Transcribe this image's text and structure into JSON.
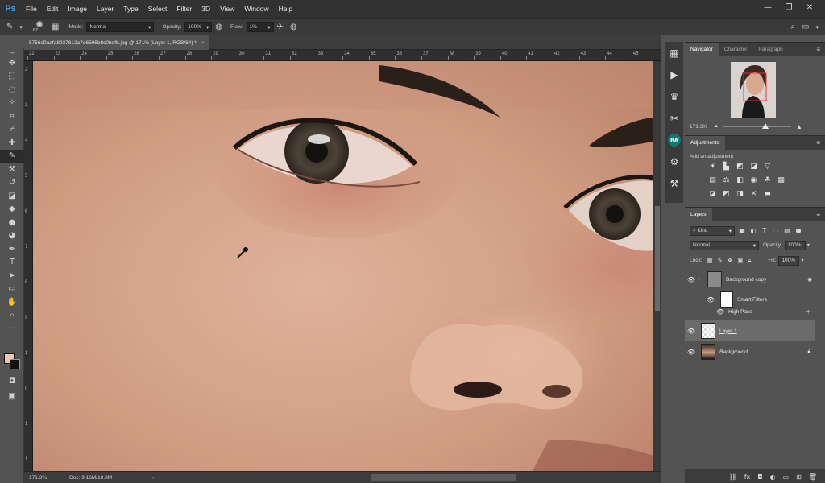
{
  "app": {
    "logo": "Ps"
  },
  "menu": [
    "File",
    "Edit",
    "Image",
    "Layer",
    "Type",
    "Select",
    "Filter",
    "3D",
    "View",
    "Window",
    "Help"
  ],
  "window_controls": [
    "—",
    "❐",
    "✕"
  ],
  "options_bar": {
    "brush_size": "67",
    "mode_label": "Mode:",
    "mode_value": "Normal",
    "opacity_label": "Opacity:",
    "opacity_value": "100%",
    "flow_label": "Flow:",
    "flow_value": "1%"
  },
  "document": {
    "tab_title": "5756d0aafa8937812a7d6595b8c0befb.jpg @ 171% (Layer 1, RGB/8#) *",
    "tab_close": "×"
  },
  "rulers": {
    "top": [
      "22",
      "23",
      "24",
      "25",
      "26",
      "27",
      "28",
      "29",
      "30",
      "31",
      "32",
      "33",
      "34",
      "35",
      "36",
      "37",
      "38",
      "39",
      "40",
      "41",
      "42",
      "43",
      "44",
      "45"
    ],
    "left": [
      "2",
      "3",
      "4",
      "5",
      "6",
      "7",
      "8",
      "9",
      "1",
      "0",
      "1",
      "1"
    ]
  },
  "status_bar": {
    "zoom": "171.3%",
    "doc_info": "Doc: 9.16M/18.3M",
    "arrow": "›"
  },
  "panels": {
    "navigator": {
      "tabs": [
        "Navigator",
        "Character",
        "Paragraph"
      ],
      "zoom": "171.3%",
      "zoom_level": 0.62
    },
    "adjustments": {
      "title": "Adjustments",
      "add_label": "Add an adjustment"
    },
    "layers": {
      "title": "Layers",
      "kind_filter": "Kind",
      "blend_mode": "Normal",
      "opacity_label": "Opacity:",
      "opacity_value": "100%",
      "lock_label": "Lock:",
      "fill_label": "Fill:",
      "fill_value": "100%",
      "items": [
        {
          "name": "Background copy",
          "type": "smart-object"
        },
        {
          "name": "Smart Filters",
          "type": "smart-filters"
        },
        {
          "name": "High Pass",
          "type": "filter"
        },
        {
          "name": "Layer 1",
          "type": "layer",
          "selected": true
        },
        {
          "name": "Background",
          "type": "background",
          "locked": true
        }
      ],
      "footer_icons": [
        "link-icon",
        "fx-icon",
        "mask-icon",
        "adjustment-layer-icon",
        "group-icon",
        "new-layer-icon",
        "trash-icon"
      ]
    }
  },
  "strip": {
    "badge": "RA"
  },
  "colors": {
    "accent": "#31a8ff",
    "skin": "#d4a38c",
    "foreground": "#f0c6aa",
    "background": "#111111"
  }
}
